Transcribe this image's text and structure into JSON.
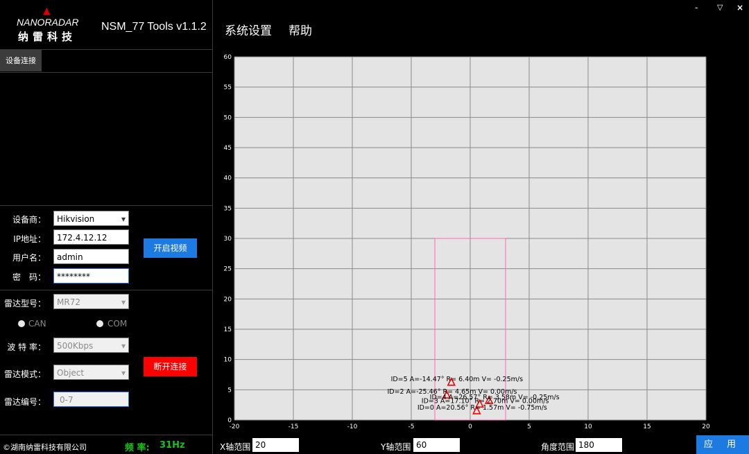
{
  "app": {
    "logo_word": "NANORADAR",
    "logo_cn": "纳雷科技",
    "title": "NSM_77 Tools v1.1.2"
  },
  "menu": {
    "settings": "系统设置",
    "help": "帮助"
  },
  "window_controls": {
    "minimize": "-",
    "maximize": "▽",
    "close": "×"
  },
  "tabs": [
    {
      "label": "设备连接"
    }
  ],
  "camera": {
    "vendor_label": "设备商：",
    "vendor_value": "Hikvision",
    "ip_label": "IP地址：",
    "ip_value": "172.4.12.12",
    "user_label": "用户名：",
    "user_value": "admin",
    "pass_label": "密　码：",
    "pass_value": "********",
    "open_video_button": "开启视频"
  },
  "radar": {
    "model_label": "雷达型号：",
    "model_value": "MR72",
    "can_label": "CAN",
    "com_label": "COM",
    "baud_label": "波 特 率：",
    "baud_value": "500Kbps",
    "mode_label": "雷达模式：",
    "mode_value": "Object",
    "id_label": "雷达编号：",
    "id_value": "0-7",
    "disconnect_button": "断开连接"
  },
  "status": {
    "copyright": "©湖南纳雷科技有限公司",
    "freq_label": "频 率:",
    "freq_value": "31Hz"
  },
  "range_bar": {
    "x_label": "X轴范围",
    "x_value": "20",
    "y_label": "Y轴范围",
    "y_value": "60",
    "angle_label": "角度范围",
    "angle_value": "180",
    "apply_button": "应 用"
  },
  "colors": {
    "accent_blue": "#1c7ae0",
    "danger_red": "#ff0000",
    "status_green": "#14c414",
    "plot_bg": "#e4e4e4",
    "zone_pink": "#ff69b4",
    "target_red": "#ff0000"
  },
  "chart_data": {
    "type": "scatter",
    "xlim": [
      -20,
      20
    ],
    "ylim": [
      0,
      60
    ],
    "x_ticks": [
      -20,
      -15,
      -10,
      -5,
      0,
      5,
      10,
      15,
      20
    ],
    "y_ticks": [
      0,
      5,
      10,
      15,
      20,
      25,
      30,
      35,
      40,
      45,
      50,
      55,
      60
    ],
    "grid": true,
    "zone": {
      "x": [
        -3,
        3
      ],
      "y": [
        0,
        30
      ]
    },
    "points": [
      {
        "x": -1.6,
        "y": 6.2,
        "label": "ID=5 A=-14.47° R= 6.40m V= -0.25m/s"
      },
      {
        "x": -2.0,
        "y": 4.1,
        "label": "ID=2 A=-25.46° R= 4.65m V= 0.00m/s"
      },
      {
        "x": 1.6,
        "y": 3.2,
        "label": "ID=4 A=26.57° R= 3.58m V= -0.25m/s"
      },
      {
        "x": 0.8,
        "y": 2.6,
        "label": "ID=3 A=17.10° R= 2.70m V= 0.00m/s"
      },
      {
        "x": 0.55,
        "y": 1.5,
        "label": "ID=0 A=20.56° R= 1.57m V= -0.75m/s"
      }
    ]
  }
}
